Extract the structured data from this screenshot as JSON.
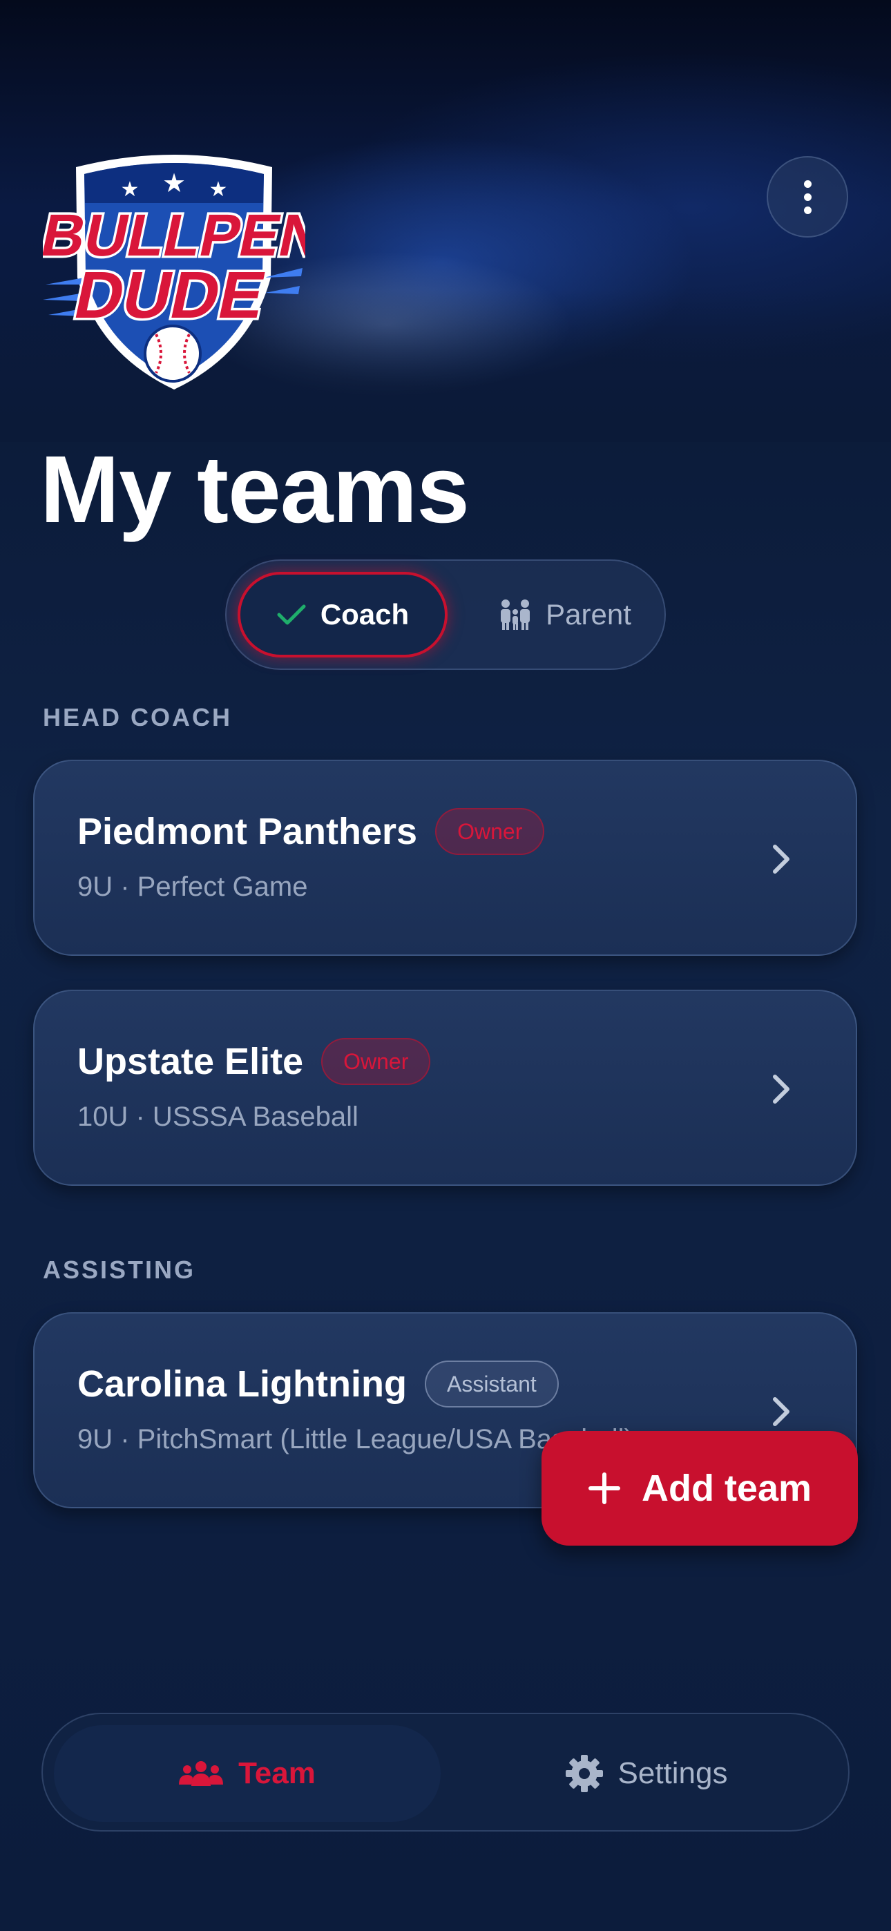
{
  "app": {
    "logo_text": [
      "BULLPEN",
      "DUDE"
    ],
    "menu_icon": "more-vertical-icon"
  },
  "page": {
    "title": "My teams"
  },
  "role_toggle": {
    "options": [
      {
        "label": "Coach",
        "icon": "check-icon",
        "selected": true
      },
      {
        "label": "Parent",
        "icon": "family-icon",
        "selected": false
      }
    ]
  },
  "sections": [
    {
      "label": "HEAD COACH",
      "teams": [
        {
          "name": "Piedmont Panthers",
          "badge": "Owner",
          "meta": "9U · Perfect Game"
        },
        {
          "name": "Upstate Elite",
          "badge": "Owner",
          "meta": "10U · USSSA Baseball"
        }
      ]
    },
    {
      "label": "ASSISTING",
      "teams": [
        {
          "name": "Carolina Lightning",
          "badge": "Assistant",
          "meta": "9U · PitchSmart (Little League/USA Baseball)"
        }
      ]
    }
  ],
  "add_team": {
    "label": "Add team",
    "icon": "plus-icon"
  },
  "tabbar": {
    "tabs": [
      {
        "label": "Team",
        "icon": "people-icon",
        "active": true
      },
      {
        "label": "Settings",
        "icon": "gear-icon",
        "active": false
      }
    ]
  },
  "colors": {
    "accent": "#c8102e",
    "background": "#0d1d3d",
    "card": "#1f345c",
    "check": "#1fae6b"
  }
}
